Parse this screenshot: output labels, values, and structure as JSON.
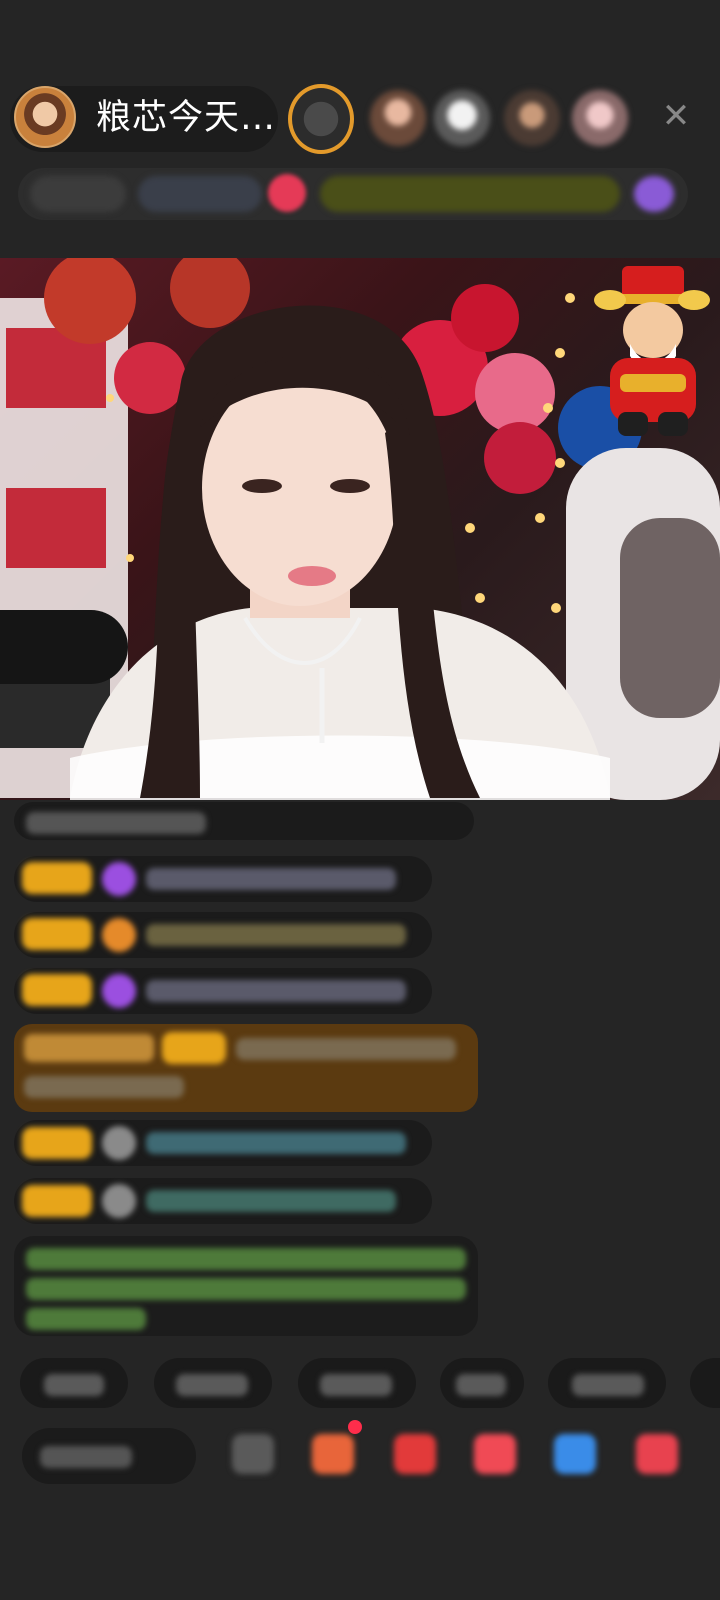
{
  "host": {
    "name": "粮芯今天…"
  },
  "header": {
    "close_icon": "close-icon",
    "close_glyph": "✕"
  },
  "colors": {
    "background": "#252525",
    "badge": "#e7a51a",
    "chat_bubble": "#1b1b1b",
    "highlight_bubble": "#5b3a10",
    "green_text": "#6fc24a"
  },
  "video": {
    "mascot_icon": "god-of-wealth-sticker",
    "microphone_icon": "microphone-icon"
  },
  "toolbar": {
    "icons": [
      "emoji-icon",
      "gift-box-icon",
      "gift-bag-icon",
      "red-heart-icon",
      "game-icon",
      "prize-icon"
    ]
  }
}
